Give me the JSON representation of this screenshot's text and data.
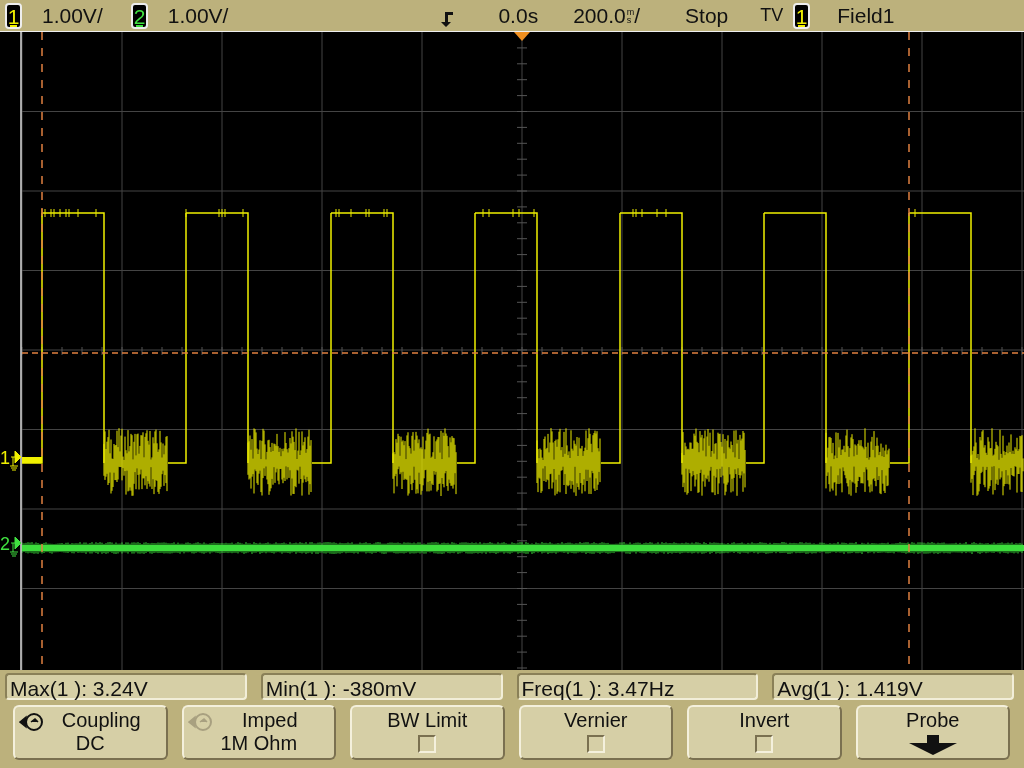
{
  "top_bar": {
    "channels": [
      {
        "number": "1",
        "scale": "1.00V/",
        "color": "#f0f000"
      },
      {
        "number": "2",
        "scale": "1.00V/",
        "color": "#40e040"
      }
    ],
    "time_ref": "0.0s",
    "time_scale": "200.0",
    "time_unit": "ms",
    "time_slash": "/",
    "run_state": "Stop",
    "trigger_mode": "TV",
    "trigger_source": {
      "number": "1",
      "color": "#f0f000"
    },
    "trigger_field": "Field1"
  },
  "display": {
    "markers": [
      {
        "number": "1",
        "color": "#f0f000"
      },
      {
        "number": "2",
        "color": "#40e040"
      }
    ]
  },
  "measurements": [
    "Max(1 ): 3.24V",
    "Min(1 ): -380mV",
    "Freq(1 ): 3.47Hz",
    "Avg(1 ): 1.419V"
  ],
  "softkeys": [
    {
      "kind": "cycle",
      "label": "Coupling",
      "value": "DC",
      "disabled": false
    },
    {
      "kind": "cycle",
      "label": "Imped",
      "value": "1M Ohm",
      "disabled": true
    },
    {
      "kind": "checkbox",
      "label": "BW Limit",
      "checked": false
    },
    {
      "kind": "checkbox",
      "label": "Vernier",
      "checked": false
    },
    {
      "kind": "checkbox",
      "label": "Invert",
      "checked": false
    },
    {
      "kind": "menu",
      "label": "Probe"
    }
  ]
}
